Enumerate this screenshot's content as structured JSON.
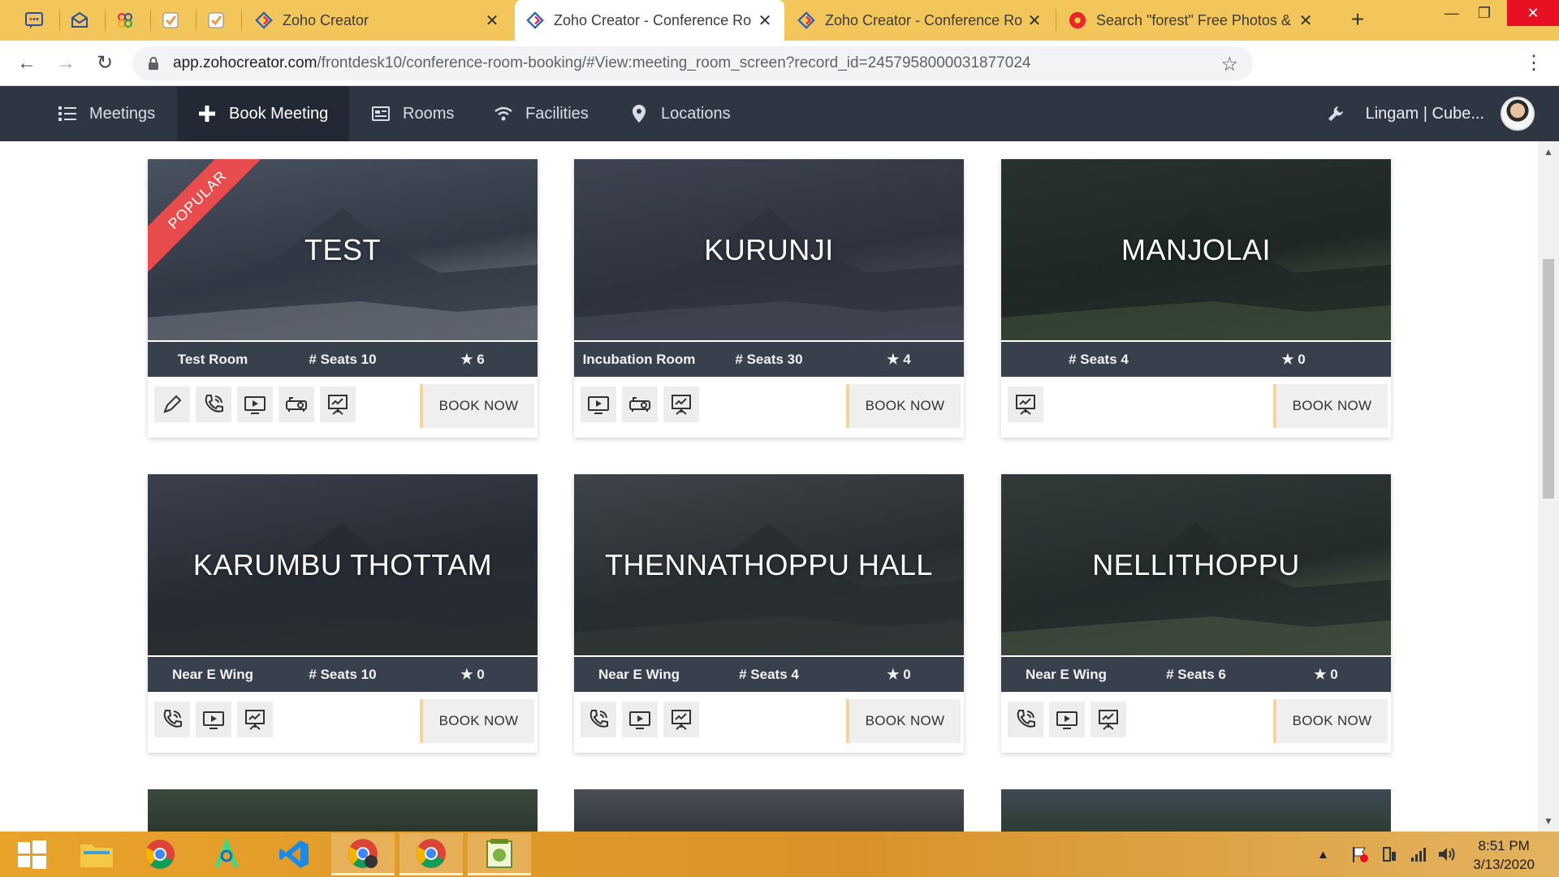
{
  "browser": {
    "tabs": [
      {
        "title": "Zoho Creator",
        "close": "✕"
      },
      {
        "title": "Zoho Creator - Conference Ro",
        "close": "✕"
      },
      {
        "title": "Zoho Creator - Conference Ro",
        "close": "✕"
      },
      {
        "title": "Search \"forest\" Free Photos &",
        "close": "✕"
      }
    ],
    "new_tab": "+",
    "window_controls": {
      "minimize": "—",
      "restore": "❐",
      "close": "✕"
    },
    "url_host": "app.zohocreator.com",
    "url_path": "/frontdesk10/conference-room-booking/#View:meeting_room_screen?record_id=2457958000031877024",
    "nav": {
      "back": "←",
      "forward": "→",
      "reload": "↻"
    },
    "bookmark_star": "☆",
    "menu": "⋮"
  },
  "appnav": {
    "items": [
      {
        "label": "Meetings",
        "icon": "list-icon"
      },
      {
        "label": "Book Meeting",
        "icon": "plus-icon"
      },
      {
        "label": "Rooms",
        "icon": "room-icon"
      },
      {
        "label": "Facilities",
        "icon": "wifi-icon"
      },
      {
        "label": "Locations",
        "icon": "location-pin-icon"
      }
    ],
    "user_name": "Lingam | Cube..."
  },
  "cards": [
    {
      "title": "TEST",
      "ribbon": "POPULAR",
      "location": "Test Room",
      "seats": "# Seats 10",
      "rating": "★ 6",
      "book": "BOOK NOW",
      "facilities": [
        "pen",
        "phone",
        "tv",
        "projector",
        "whiteboard"
      ],
      "colors": [
        "#5b6674",
        "#3a424f",
        "#c9cdd3"
      ]
    },
    {
      "title": "KURUNJI",
      "location": "Incubation Room",
      "seats": "# Seats 30",
      "rating": "★ 4",
      "book": "BOOK NOW",
      "facilities": [
        "tv",
        "projector",
        "whiteboard"
      ],
      "colors": [
        "#4b5260",
        "#353a45",
        "#6e7480"
      ]
    },
    {
      "title": "MANJOLAI",
      "location": "",
      "seats": "# Seats 4",
      "rating": "★ 0",
      "book": "BOOK NOW",
      "facilities": [
        "whiteboard"
      ],
      "colors": [
        "#2d3a2f",
        "#1f2a22",
        "#6e8a5a"
      ]
    },
    {
      "title": "KARUMBU THOTTAM",
      "location": "Near E Wing",
      "seats": "# Seats 10",
      "rating": "★ 0",
      "book": "BOOK NOW",
      "facilities": [
        "phone",
        "tv",
        "whiteboard"
      ],
      "colors": [
        "#474e5a",
        "#2a2f36",
        "#343b33"
      ]
    },
    {
      "title": "THENNATHOPPU HALL",
      "location": "Near E Wing",
      "seats": "# Seats 4",
      "rating": "★ 0",
      "book": "BOOK NOW",
      "facilities": [
        "phone",
        "tv",
        "whiteboard"
      ],
      "colors": [
        "#4c5355",
        "#2d3333",
        "#495049"
      ]
    },
    {
      "title": "NELLITHOPPU",
      "location": "Near E Wing",
      "seats": "# Seats 6",
      "rating": "★ 0",
      "book": "BOOK NOW",
      "facilities": [
        "phone",
        "tv",
        "whiteboard"
      ],
      "colors": [
        "#3a4640",
        "#26302b",
        "#7c9360"
      ]
    }
  ],
  "taskbar": {
    "time": "8:51 PM",
    "date": "3/13/2020",
    "tray_chevron": "▲"
  },
  "colors": {
    "nav_bg": "#2f3643",
    "nav_active": "#232934",
    "meta_bg": "#39404d",
    "ribbon": "#e84c4c",
    "book_accent": "#f7d49b",
    "tabstrip": "#f2c65a"
  }
}
